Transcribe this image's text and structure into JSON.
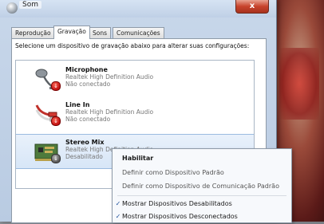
{
  "window": {
    "title": "Som",
    "close_label": "x"
  },
  "tabs": [
    {
      "label": "Reprodução",
      "active": false
    },
    {
      "label": "Gravação",
      "active": true
    },
    {
      "label": "Sons",
      "active": false
    },
    {
      "label": "Comunicações",
      "active": false
    }
  ],
  "instructions": "Selecione um dispositivo de gravação abaixo para alterar suas configurações:",
  "devices": [
    {
      "name": "Microphone",
      "driver": "Realtek High Definition Audio",
      "status": "Não conectado",
      "icon": "microphone-icon",
      "status_badge": "unplugged-badge"
    },
    {
      "name": "Line In",
      "driver": "Realtek High Definition Audio",
      "status": "Não conectado",
      "icon": "line-in-cable-icon",
      "status_badge": "unplugged-badge"
    },
    {
      "name": "Stereo Mix",
      "driver": "Realtek High Definition Audio",
      "status": "Desabilitado",
      "icon": "sound-card-icon",
      "status_badge": "disabled-badge",
      "selected": true
    }
  ],
  "context_menu": {
    "items": [
      {
        "label": "Habilitar",
        "bold": true,
        "disabled": false,
        "checked": false
      },
      {
        "label": "Definir como Dispositivo Padrão",
        "disabled": true,
        "checked": false
      },
      {
        "label": "Definir como Dispositivo de Comunicação Padrão",
        "disabled": true,
        "checked": false
      },
      {
        "label": "Mostrar Dispositivos Desabilitados",
        "disabled": false,
        "checked": true
      },
      {
        "label": "Mostrar Dispositivos Desconectados",
        "disabled": false,
        "checked": true
      }
    ],
    "check_glyph": "✓"
  },
  "colors": {
    "accent_check": "#1d4f9a",
    "close_red": "#c8432c",
    "selection_blue": "#d7e6f7"
  }
}
